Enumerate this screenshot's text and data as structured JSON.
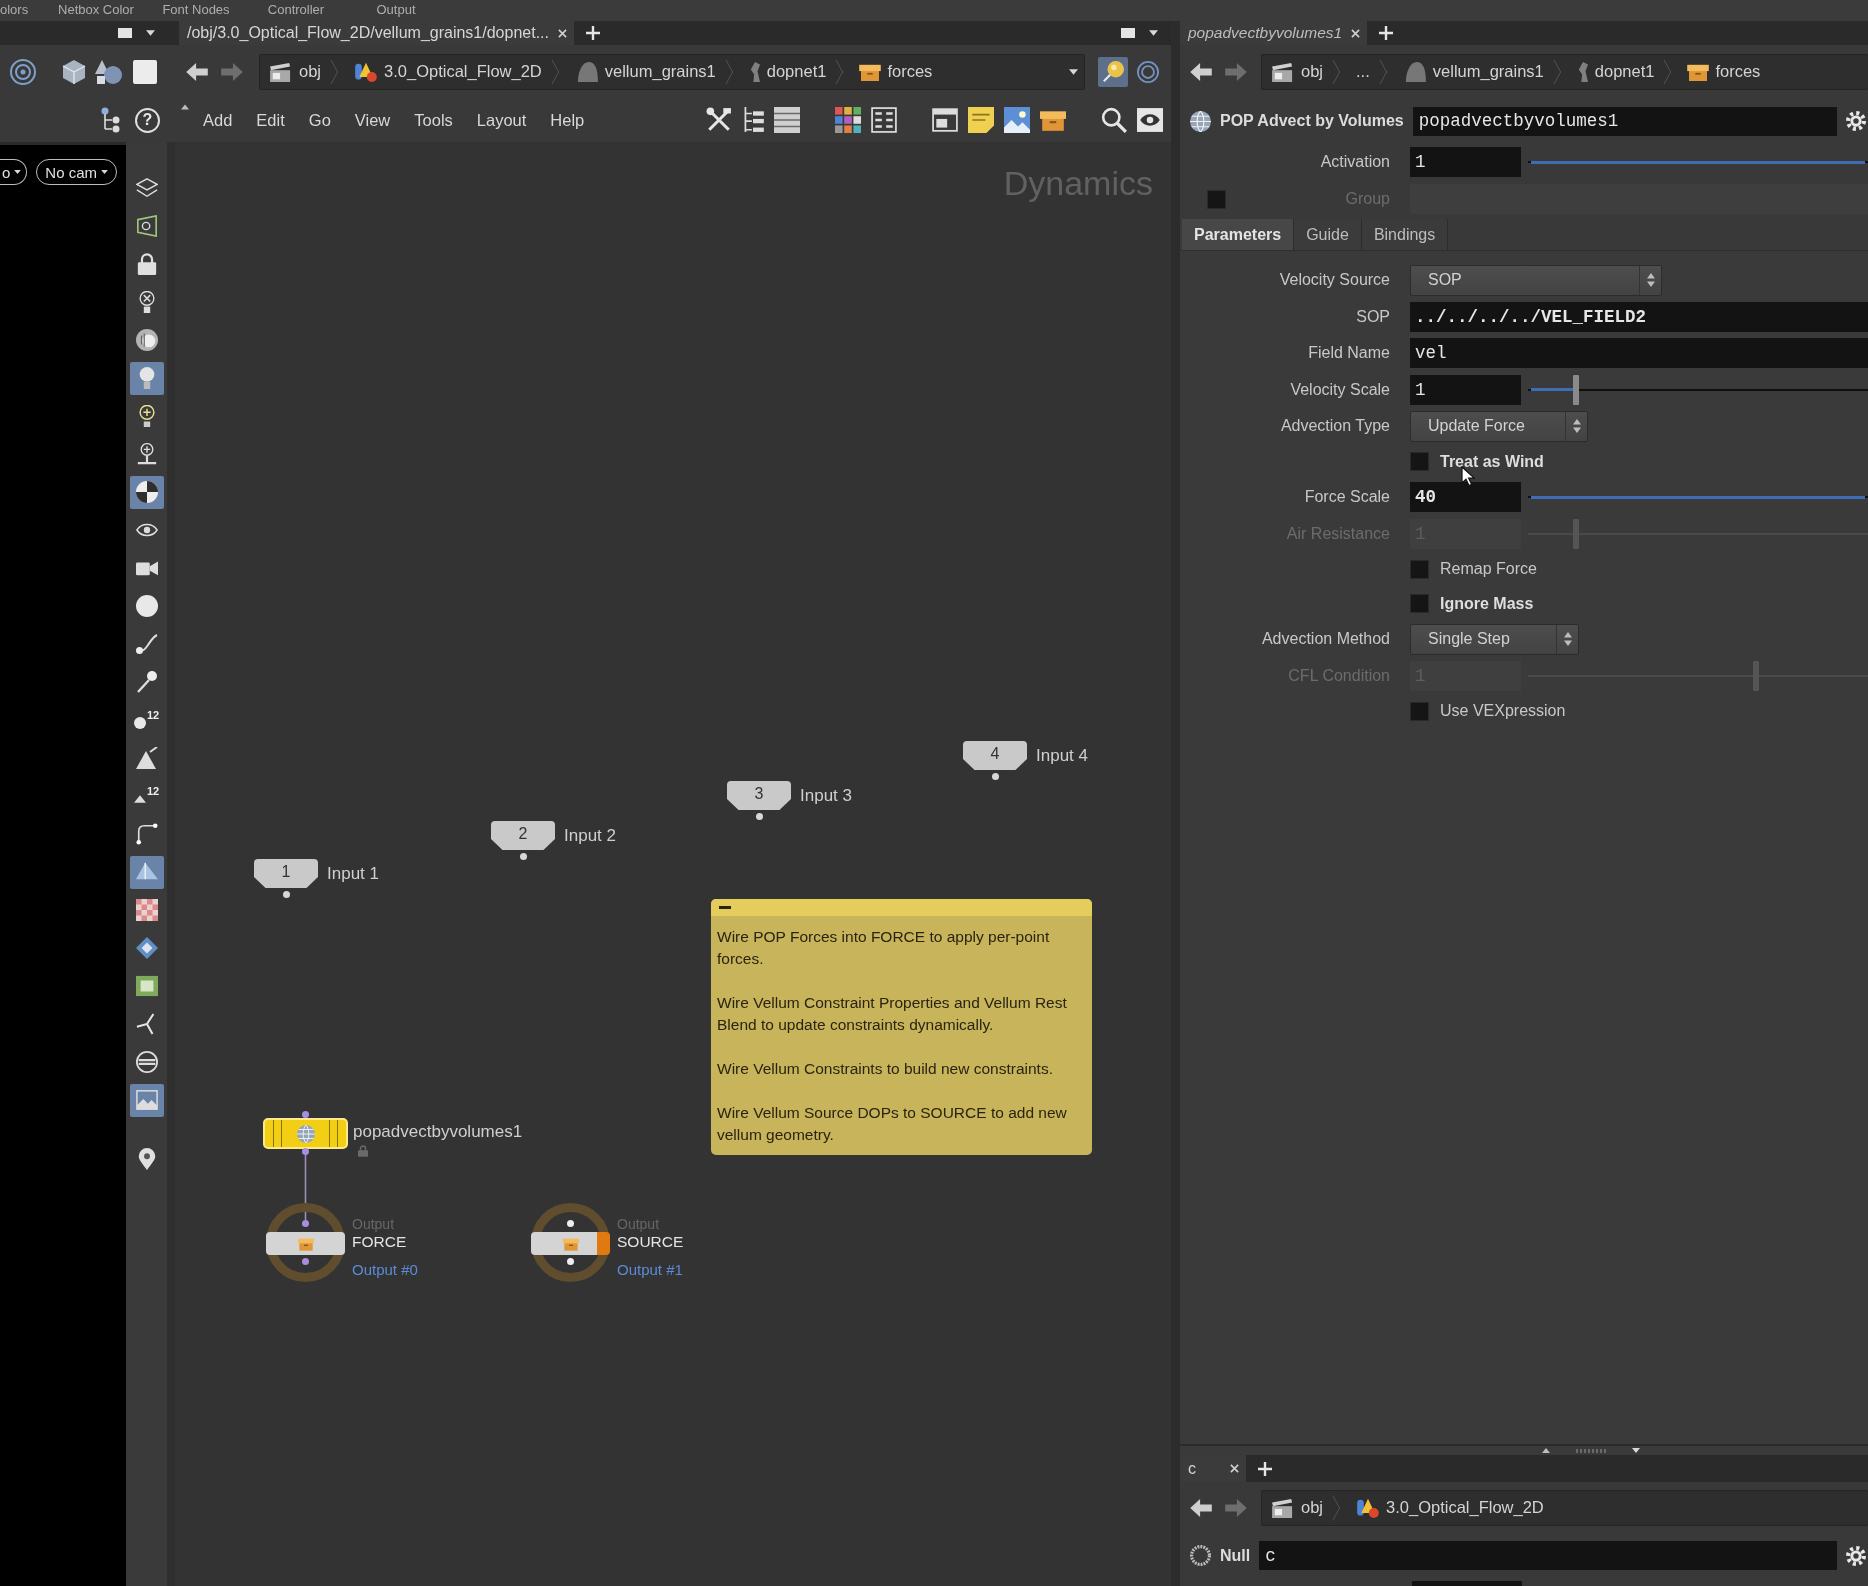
{
  "shelf": {
    "labels": [
      "olors",
      "Netbox Color",
      "Font Nodes",
      "Controller",
      "Output"
    ]
  },
  "left_pane": {
    "help": "?",
    "camera_menus": [
      "o",
      "No cam"
    ],
    "tools": [
      [
        {
          "on": false
        },
        {
          "on": false
        },
        {
          "on": false
        },
        {
          "on": false
        },
        {
          "on": false
        },
        {
          "on": true
        },
        {
          "on": false
        },
        {
          "on": false
        },
        {
          "on": true
        },
        {
          "on": false
        },
        {
          "on": false
        },
        {
          "on": false
        },
        {
          "on": false
        },
        {
          "on": false
        },
        {
          "on": false,
          "label": "12"
        },
        {
          "on": false
        },
        {
          "on": false,
          "label": "12"
        },
        {
          "on": false
        },
        {
          "on": true
        },
        {
          "on": false
        },
        {
          "on": false
        },
        {
          "on": false
        },
        {
          "on": false
        },
        {
          "on": false
        },
        {
          "on": true
        }
      ],
      [
        {
          "on": false
        }
      ]
    ]
  },
  "network_pane": {
    "tab": {
      "label": "/obj/3.0_Optical_Flow_2D/vellum_grains1/dopnet...",
      "selected": true
    },
    "path": [
      {
        "kind": "obj",
        "label": "obj"
      },
      {
        "kind": "geo",
        "label": "3.0_Optical_Flow_2D"
      },
      {
        "kind": "vellum",
        "label": "vellum_grains1"
      },
      {
        "kind": "dopnet",
        "label": "dopnet1"
      },
      {
        "kind": "subnet",
        "label": "forces"
      }
    ],
    "pin_on": true,
    "menu": [
      "Add",
      "Edit",
      "Go",
      "View",
      "Tools",
      "Layout",
      "Help"
    ],
    "context": "Dynamics",
    "inputs": [
      {
        "number": "1",
        "label": "Input 1"
      },
      {
        "number": "2",
        "label": "Input 2"
      },
      {
        "number": "3",
        "label": "Input 3"
      },
      {
        "number": "4",
        "label": "Input 4"
      }
    ],
    "node": {
      "name": "popadvectbyvolumes1",
      "selected": true
    },
    "outputs": [
      {
        "caption": "Output",
        "name": "FORCE",
        "port": "Output #0",
        "connected": true,
        "flag": false
      },
      {
        "caption": "Output",
        "name": "SOURCE",
        "port": "Output #1",
        "connected": false,
        "flag": true
      }
    ],
    "note": {
      "paragraphs": [
        "Wire POP Forces into FORCE to apply per-point forces.",
        "Wire Vellum Constraint Properties and Vellum Rest Blend to update constraints dynamically.",
        "Wire Vellum Constraints to build new constraints.",
        "Wire Vellum Source DOPs to SOURCE to add new vellum geometry."
      ]
    }
  },
  "parameter_pane": {
    "tab": {
      "label": "popadvectbyvolumes1",
      "selected": true
    },
    "path": [
      {
        "kind": "obj",
        "label": "obj"
      },
      {
        "kind": "more",
        "label": "..."
      },
      {
        "kind": "vellum",
        "label": "vellum_grains1"
      },
      {
        "kind": "dopnet",
        "label": "dopnet1"
      },
      {
        "kind": "subnet",
        "label": "forces"
      }
    ],
    "node_type": "POP Advect by Volumes",
    "node_name": "popadvectbyvolumes1",
    "activation": {
      "label": "Activation",
      "value": "1",
      "level": 1
    },
    "group": {
      "label": "Group",
      "checked": false,
      "disabled": true
    },
    "tabs": [
      {
        "label": "Parameters",
        "selected": true
      },
      {
        "label": "Guide",
        "selected": false
      },
      {
        "label": "Bindings",
        "selected": false
      }
    ],
    "parameters": [
      {
        "kind": "menu",
        "label": "Velocity Source",
        "value": "SOP",
        "disabled": false,
        "modified": false
      },
      {
        "kind": "text",
        "label": "SOP",
        "value": "../../../../VEL_FIELD2",
        "disabled": false,
        "modified": true
      },
      {
        "kind": "text",
        "label": "Field Name",
        "value": "vel",
        "disabled": false,
        "modified": false
      },
      {
        "kind": "slider",
        "label": "Velocity Scale",
        "value": "1",
        "level": 0.135,
        "disabled": false,
        "modified": false
      },
      {
        "kind": "menu",
        "label": "Advection Type",
        "value": "Update Force",
        "disabled": false,
        "modified": false
      },
      {
        "kind": "checkbox",
        "label": "Treat as Wind",
        "checked": false,
        "disabled": false,
        "modified": true
      },
      {
        "kind": "slider",
        "label": "Force Scale",
        "value": "40",
        "level": 1,
        "disabled": false,
        "modified": true
      },
      {
        "kind": "slider",
        "label": "Air Resistance",
        "value": "1",
        "level": 0.135,
        "disabled": true,
        "modified": false
      },
      {
        "kind": "checkbox",
        "label": "Remap Force",
        "checked": false,
        "disabled": false,
        "modified": false
      },
      {
        "kind": "checkbox",
        "label": "Ignore Mass",
        "checked": false,
        "disabled": false,
        "modified": true
      },
      {
        "kind": "menu",
        "label": "Advection Method",
        "value": "Single Step",
        "disabled": false,
        "modified": false
      },
      {
        "kind": "slider",
        "label": "CFL Condition",
        "value": "1",
        "level": 0.674,
        "disabled": true,
        "modified": false
      },
      {
        "kind": "checkbox",
        "label": "Use VEXpression",
        "checked": false,
        "disabled": false,
        "modified": false
      }
    ]
  },
  "bottom_pane": {
    "tab": {
      "label": "c",
      "selected": true
    },
    "path": [
      {
        "kind": "obj",
        "label": "obj"
      },
      {
        "kind": "geo",
        "label": "3.0_Optical_Flow_2D"
      }
    ],
    "node_type": "Null",
    "node_name": "c"
  }
}
